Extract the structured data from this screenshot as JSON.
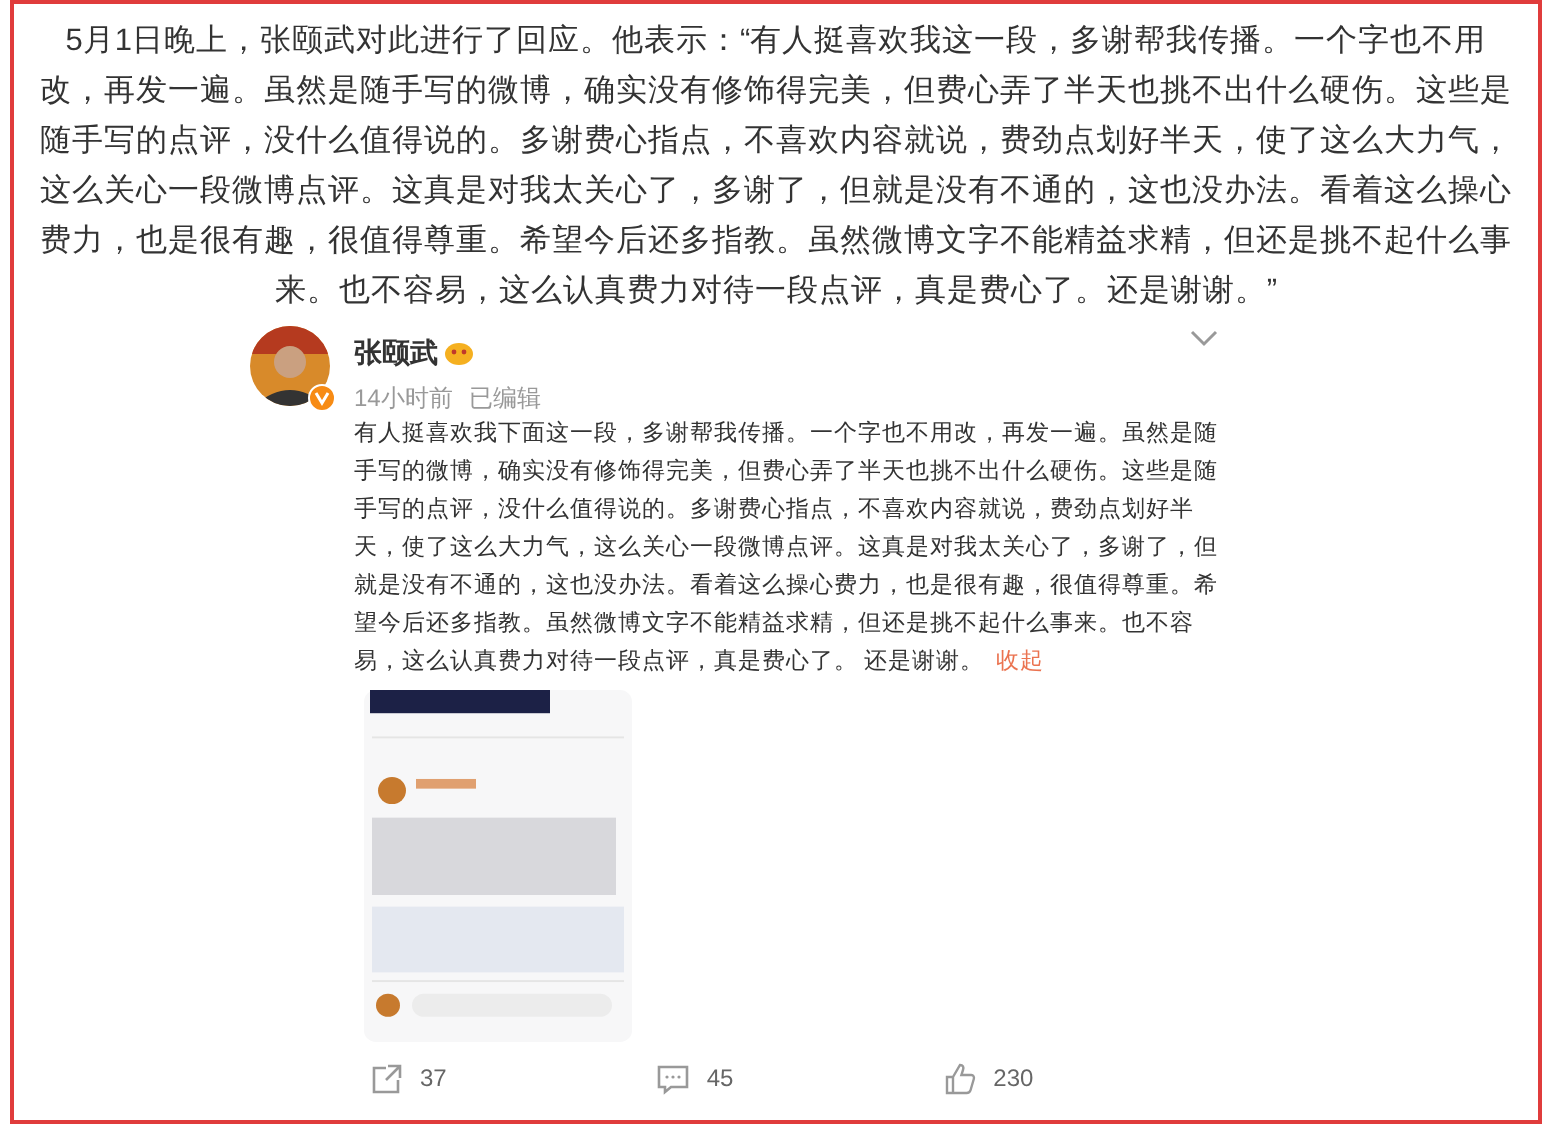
{
  "article": {
    "paragraph": "5月1日晚上，张颐武对此进行了回应。他表示：“有人挺喜欢我这一段，多谢帮我传播。一个字也不用改，再发一遍。虽然是随手写的微博，确实没有修饰得完美，但费心弄了半天也挑不出什么硬伤。这些是随手写的点评，没什么值得说的。多谢费心指点，不喜欢内容就说，费劲点划好半天，使了这么大力气，这么关心一段微博点评。这真是对我太关心了，多谢了，但就是没有不通的，这也没办法。看着这么操心费力，也是很有趣，很值得尊重。希望今后还多指教。虽然微博文字不能精益求精，但还是挑不起什么事来。也不容易，这么认真费力对待一段点评，真是费心了。还是谢谢。”"
  },
  "post": {
    "author": "张颐武",
    "time": "14小时前",
    "edited": "已编辑",
    "text": "有人挺喜欢我下面这一段，多谢帮我传播。一个字也不用改，再发一遍。虽然是随手写的微博，确实没有修饰得完美，但费心弄了半天也挑不出什么硬伤。这些是随手写的点评，没什么值得说的。多谢费心指点，不喜欢内容就说，费劲点划好半天，使了这么大力气，这么关心一段微博点评。这真是对我太关心了，多谢了，但就是没有不通的，这也没办法。看着这么操心费力，也是很有趣，很值得尊重。希望今后还多指教。虽然微博文字不能精益求精，但还是挑不起什么事来。也不容易，这么认真费力对待一段点评，真是费心了。 还是谢谢。",
    "collapse_link": "收起",
    "actions": [
      {
        "kind": "share",
        "count": "37"
      },
      {
        "kind": "comment",
        "count": "45"
      },
      {
        "kind": "like",
        "count": "230"
      }
    ]
  }
}
